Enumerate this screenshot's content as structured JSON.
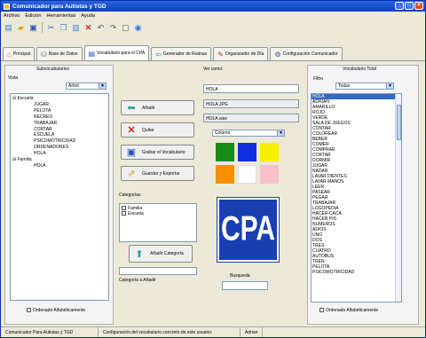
{
  "window": {
    "title": "Comunicador para Autistas y TGD",
    "min": "_",
    "max": "□",
    "close": "×"
  },
  "menu": [
    "Archivo",
    "Edición",
    "Herramientas",
    "Ayuda"
  ],
  "toolbar": {
    "icons": [
      "new-icon",
      "open-icon",
      "save-icon",
      "cut-icon",
      "copy-icon",
      "paste-icon",
      "delete-icon",
      "undo-icon",
      "redo-icon",
      "window-icon",
      "help-icon"
    ]
  },
  "tabs": [
    {
      "label": "Principal",
      "icon": "home-icon"
    },
    {
      "label": "Base de Datos",
      "icon": "database-icon"
    },
    {
      "label": "Vocabulario para el CPA",
      "icon": "vocabulary-icon",
      "active": true
    },
    {
      "label": "Generador de Rutinas",
      "icon": "routine-icon"
    },
    {
      "label": "Organizador de Día",
      "icon": "organizer-icon"
    },
    {
      "label": "Configuración Comunicador",
      "icon": "config-icon"
    }
  ],
  "left": {
    "group_title": "Subvocabularios",
    "view_label": "Vista",
    "view_value": "Árbol",
    "tree": [
      "Escuela",
      "JUGAR",
      "PELOTA",
      "RECREO",
      "TRABAJAR",
      "CORTAR",
      "ESCUELA",
      "PSICOMOTRICIDAD",
      "ORDENADORES",
      "HOLA",
      "Familia",
      "HOLA"
    ],
    "sort_label": "Ordenado Alfabéticamente"
  },
  "actions": {
    "add": "Añadir",
    "remove": "Quitar",
    "save_vocab": "Grabar el Vocabulario",
    "save_export": "Guardar y Exportar"
  },
  "categories": {
    "label": "Categorías",
    "items": [
      "Familia",
      "Escuela"
    ],
    "add_button": "Añadir Categoría",
    "add_label": "Categoría a Añadir"
  },
  "detail": {
    "view_as_label": "Ver como:",
    "word": "HOLA",
    "image_file": "HOLA.JPG",
    "sound_file": "HOLA.wav",
    "color_select": "Colores",
    "colors": [
      "#1a8a1a",
      "#1030e0",
      "#f8f000",
      "#f89000",
      "#ffffff",
      "#f8c0c8"
    ],
    "pictogram_text": "CPA",
    "search_label": "Busqueda"
  },
  "right": {
    "group_title": "Vocabulario Total",
    "filter_label": "Filtro",
    "filter_value": "Todas",
    "items": [
      "HOLA",
      "ADRIAN",
      "AMARILLO",
      "ROJO",
      "VERDE",
      "SALA DE JUEGOS",
      "CONTAR",
      "COLOREAR",
      "BEBER",
      "COMER",
      "COMPRAR",
      "CORTAR",
      "DORMIR",
      "JUGAR",
      "NADAR",
      "LAVAR DIENTES",
      "LAVAR MANOS",
      "LEER",
      "PASEAR",
      "PEGAR",
      "TRABAJAR",
      "LOGOPEDIA",
      "HACER CACA",
      "HACER PIS",
      "NUMEROS",
      "ADIOS",
      "UNO",
      "DOS",
      "TRES",
      "CUATRO",
      "AUTOBUS",
      "TREN",
      "PELOTA",
      "PSICOMOTRICIDAD"
    ],
    "sort_label": "Ordenado Alfabéticamente"
  },
  "status": [
    "Comunicador Para Autistas y TGD",
    "Configuración del vocabulario concreto de este usuario:",
    "Adrian"
  ]
}
